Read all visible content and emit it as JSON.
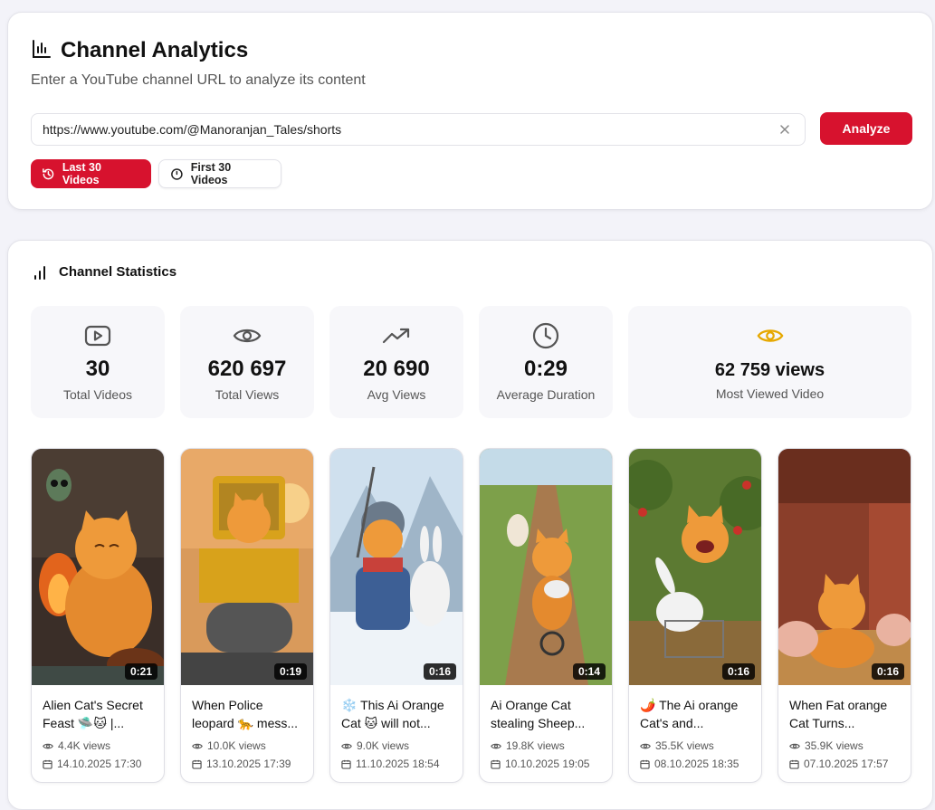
{
  "header": {
    "title": "Channel Analytics",
    "subtitle": "Enter a YouTube channel URL to analyze its content",
    "url_value": "https://www.youtube.com/@Manoranjan_Tales/shorts",
    "analyze_label": "Analyze",
    "last_label": "Last 30 Videos",
    "first_label": "First 30 Videos"
  },
  "stats": {
    "heading": "Channel Statistics",
    "items": [
      {
        "value": "30",
        "label": "Total Videos",
        "icon": "video-icon"
      },
      {
        "value": "620 697",
        "label": "Total Views",
        "icon": "eye-icon"
      },
      {
        "value": "20 690",
        "label": "Avg Views",
        "icon": "trending-up-icon"
      },
      {
        "value": "0:29",
        "label": "Average Duration",
        "icon": "clock-icon"
      },
      {
        "value": "62 759 views",
        "label": "Most Viewed Video",
        "icon": "eye-icon"
      }
    ]
  },
  "videos": [
    {
      "title": "Alien Cat's Secret Feast 🛸🐱 |...",
      "duration": "0:21",
      "views": "4.4K views",
      "date": "14.10.2025 17:30"
    },
    {
      "title": "When Police leopard 🐆 mess...",
      "duration": "0:19",
      "views": "10.0K views",
      "date": "13.10.2025 17:39"
    },
    {
      "title": "❄️ This Ai Orange Cat 🐱 will not...",
      "duration": "0:16",
      "views": "9.0K views",
      "date": "11.10.2025 18:54"
    },
    {
      "title": "Ai Orange Cat stealing Sheep...",
      "duration": "0:14",
      "views": "19.8K views",
      "date": "10.10.2025 19:05"
    },
    {
      "title": "🌶️ The Ai orange Cat's and...",
      "duration": "0:16",
      "views": "35.5K views",
      "date": "08.10.2025 18:35"
    },
    {
      "title": "When Fat orange Cat Turns...",
      "duration": "0:16",
      "views": "35.9K views",
      "date": "07.10.2025 17:57"
    }
  ],
  "colors": {
    "accent": "#d7122e",
    "highlight": "#e6a800"
  }
}
